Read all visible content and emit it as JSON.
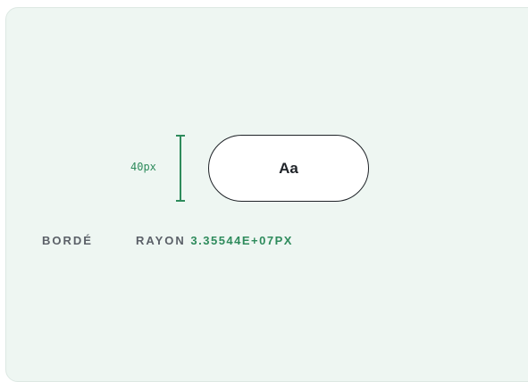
{
  "demo": {
    "height_label": "40px",
    "button_label": "Aa",
    "shape_label": "BORDÉ",
    "radius_label": "RAYON",
    "radius_value": "3.35544E+07PX"
  },
  "colors": {
    "card_background": "#eef6f2",
    "accent": "#2e8b5c",
    "text_dark": "#1f2328",
    "text_muted": "#5b6068"
  },
  "icons": [
    "height-measure-icon"
  ]
}
